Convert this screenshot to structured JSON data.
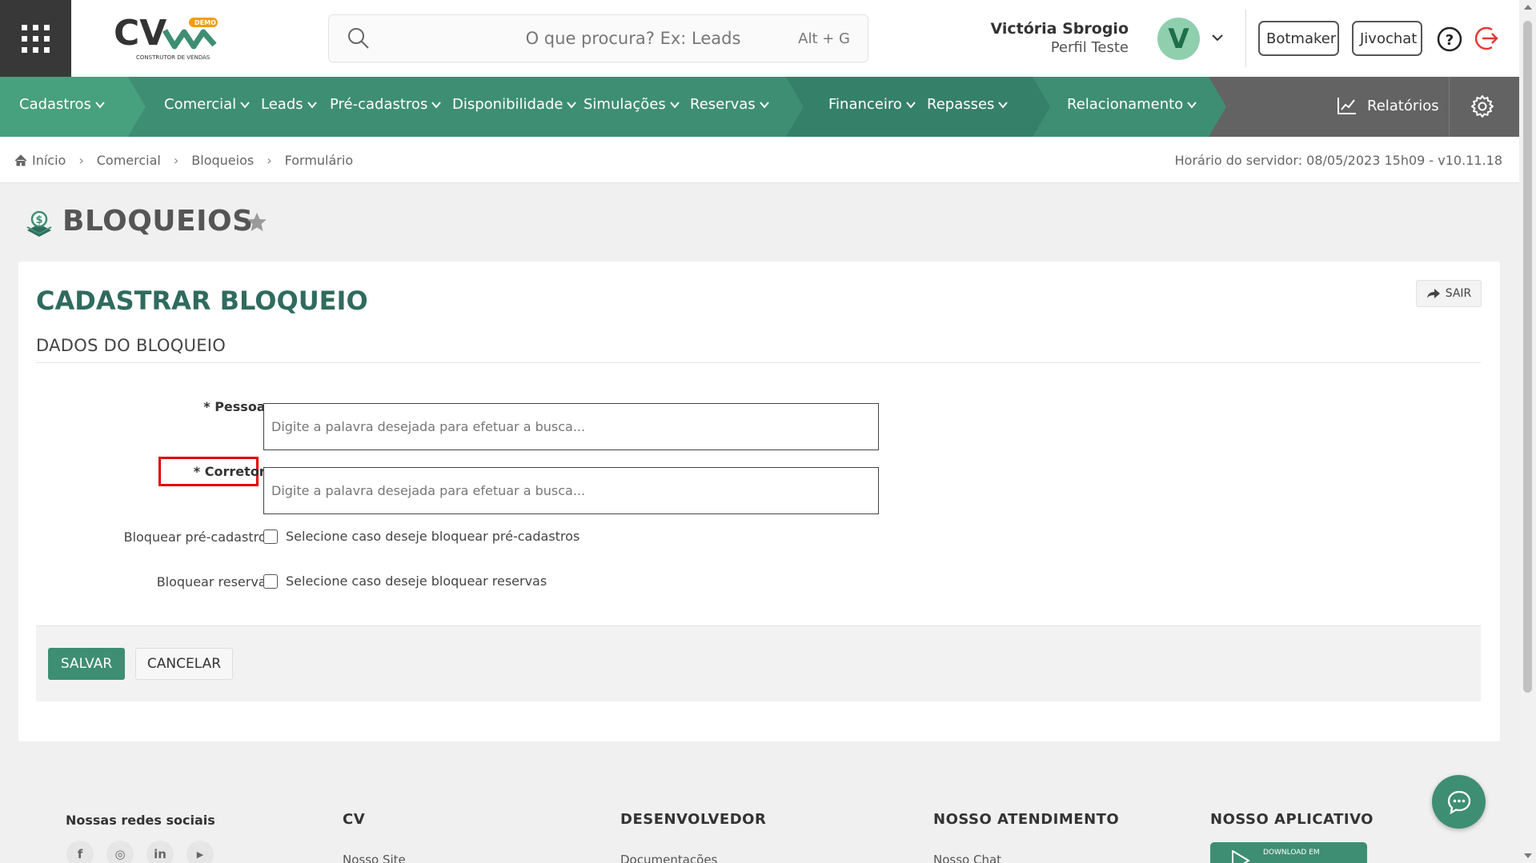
{
  "app": {
    "logo_text": "CV",
    "logo_badge": "DEMO",
    "logo_tagline": "CONSTRUTOR DE VENDAS"
  },
  "search": {
    "placeholder": "O que procura? Ex: Leads",
    "shortcut": "Alt + G"
  },
  "user": {
    "name": "Victória Sbrogio",
    "profile": "Perfil Teste",
    "avatar_letter": "V"
  },
  "header_buttons": {
    "botmaker": "Botmaker",
    "jivochat": "Jivochat"
  },
  "nav": {
    "items": [
      {
        "label": "Cadastros"
      },
      {
        "label": "Comercial"
      },
      {
        "label": "Leads"
      },
      {
        "label": "Pré-cadastros"
      },
      {
        "label": "Disponibilidade"
      },
      {
        "label": "Simulações"
      },
      {
        "label": "Reservas"
      },
      {
        "label": "Financeiro"
      },
      {
        "label": "Repasses"
      },
      {
        "label": "Relacionamento"
      }
    ],
    "reports": "Relatórios"
  },
  "breadcrumb": {
    "items": [
      "Início",
      "Comercial",
      "Bloqueios",
      "Formulário"
    ],
    "server_time": "Horário do servidor: 08/05/2023 15h09 - v10.11.18"
  },
  "page": {
    "title": "BLOQUEIOS"
  },
  "form": {
    "title": "CADASTRAR BLOQUEIO",
    "exit_label": "SAIR",
    "section": "DADOS DO BLOQUEIO",
    "pessoa_label": "* Pessoa:",
    "pessoa_placeholder": "Digite a palavra desejada para efetuar a busca...",
    "corretor_label": "* Corretor:",
    "corretor_placeholder": "Digite a palavra desejada para efetuar a busca...",
    "bloq_pre_label": "Bloquear pré-cadastro:",
    "bloq_pre_text": "Selecione caso deseje bloquear pré-cadastros",
    "bloq_reserva_label": "Bloquear reserva:",
    "bloq_reserva_text": "Selecione caso deseje bloquear reservas",
    "save": "SALVAR",
    "cancel": "CANCELAR"
  },
  "footer": {
    "social_title": "Nossas redes sociais",
    "social_icons": [
      "f",
      "◎",
      "in",
      "▶"
    ],
    "columns": [
      {
        "title": "CV",
        "link": "Nosso Site"
      },
      {
        "title": "DESENVOLVEDOR",
        "link": "Documentações"
      },
      {
        "title": "NOSSO ATENDIMENTO",
        "link": "Nosso Chat"
      },
      {
        "title": "NOSSO APLICATIVO"
      }
    ],
    "app_badge": "DOWNLOAD EM"
  },
  "colors": {
    "brand_green": "#3e8e74",
    "nav_gray": "#636363",
    "highlight_red": "#e10000"
  },
  "icons": [
    "apps-grid-icon",
    "search-icon",
    "chevron-down-icon",
    "help-icon",
    "logout-icon",
    "chart-icon",
    "gear-icon",
    "home-icon",
    "money-stack-icon",
    "star-icon",
    "share-icon",
    "chat-icon"
  ]
}
